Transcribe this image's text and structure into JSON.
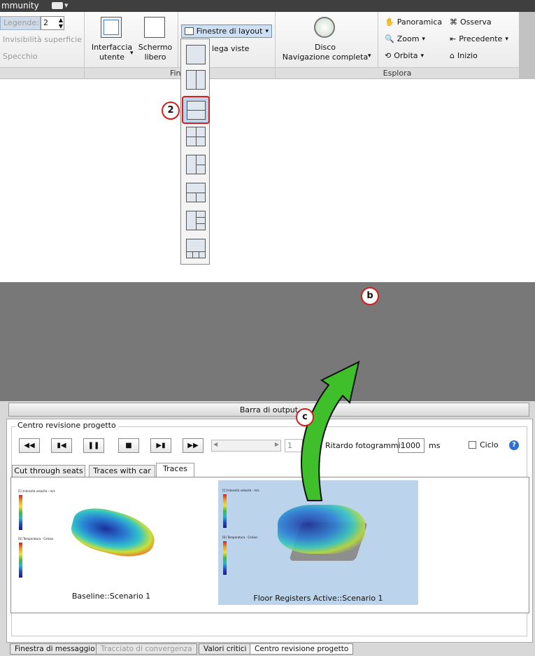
{
  "titlebar": {
    "text": "mmunity"
  },
  "ribbon": {
    "legend_label": "Legende:",
    "legend_value": "2",
    "invisibility": "Invisibilità superficie",
    "mirror": "Specchio",
    "ui_btn_line1": "Interfaccia",
    "ui_btn_line2": "utente",
    "fullscreen_line1": "Schermo",
    "fullscreen_line2": "libero",
    "layout_windows_btn": "Finestre di layout",
    "link_views": "lega viste",
    "panel_windows": "Fines",
    "disc_line1": "Disco",
    "disc_line2": "Navigazione completa",
    "pan": "Panoramica",
    "zoom": "Zoom",
    "orbit": "Orbita",
    "look": "Osserva",
    "previous": "Precedente",
    "home": "Inizio",
    "panel_explore": "Esplora"
  },
  "callouts": {
    "two": "2",
    "b": "b",
    "c": "c"
  },
  "output": {
    "bar_title": "Barra di output",
    "group_title": "Centro revisione progetto",
    "frame_input": "1",
    "delay_label": "Ritardo fotogrammi:",
    "delay_value": "1000",
    "delay_unit": "ms",
    "loop_label": "Ciclo",
    "help": "?",
    "tabs": [
      "Cut through seats",
      "Traces with car",
      "Traces"
    ],
    "thumb1_caption": "Baseline::Scenario 1",
    "thumb2_caption": "Floor Registers Active::Scenario 1",
    "legend_velocity": "[1] Intensità velocità - m/s",
    "legend_temp": "[6] Temperatura - Celsius",
    "bottom_tabs": [
      "Finestra di messaggio",
      "Tracciato di convergenza",
      "Valori critici",
      "Centro revisione progetto"
    ]
  },
  "colors": {
    "accent": "#d21f1f",
    "arrow": "#3fbf2a",
    "selected": "#bcd3ec"
  }
}
